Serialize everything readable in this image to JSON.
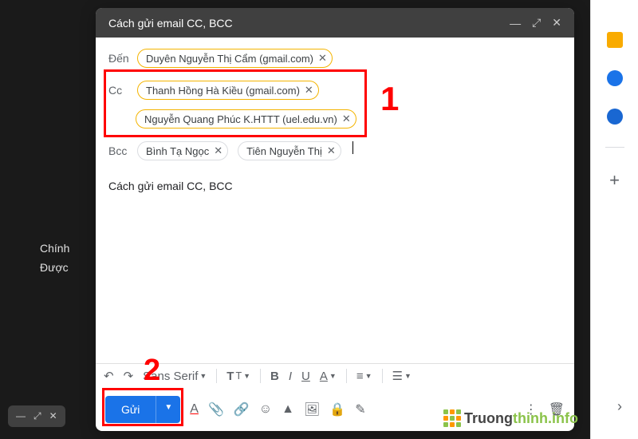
{
  "window": {
    "title": "Cách gửi email CC, BCC"
  },
  "bg": {
    "line1": "Chính",
    "line2": "Được"
  },
  "recipients": {
    "to_label": "Đến",
    "to": [
      {
        "text": "Duyên Nguyễn Thị Cẩm (gmail.com)"
      }
    ],
    "cc_label": "Cc",
    "cc": [
      {
        "text": "Thanh Hồng Hà Kiều (gmail.com)"
      },
      {
        "text": "Nguyễn Quang Phúc K.HTTT (uel.edu.vn)"
      }
    ],
    "bcc_label": "Bcc",
    "bcc": [
      {
        "text": "Bình Tạ Ngọc"
      },
      {
        "text": "Tiên Nguyễn Thị"
      }
    ]
  },
  "body": "Cách gửi email CC, BCC",
  "toolbar": {
    "font": "Sans Serif"
  },
  "send": {
    "label": "Gửi"
  },
  "annotations": {
    "one": "1",
    "two": "2"
  },
  "watermark": {
    "text": "Truong",
    "suffix": "thinh.info"
  },
  "sidebar_colors": {
    "keep": "#f9ab00",
    "tasks": "#1a73e8",
    "contacts": "#1967d2"
  }
}
